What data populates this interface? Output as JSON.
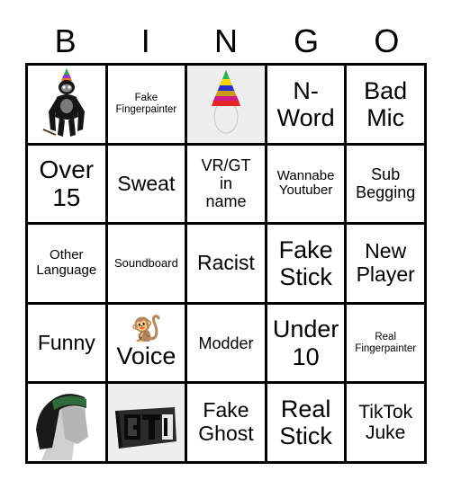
{
  "header": {
    "letters": [
      "B",
      "I",
      "N",
      "G",
      "O"
    ]
  },
  "cells": [
    {
      "type": "image",
      "icon": "gorilla-party-hat-icon"
    },
    {
      "type": "text",
      "text": "Fake Fingerpainter"
    },
    {
      "type": "image",
      "icon": "party-hat-icon"
    },
    {
      "type": "text",
      "text": "N- Word"
    },
    {
      "type": "text",
      "text": "Bad Mic"
    },
    {
      "type": "text",
      "text": "Over 15"
    },
    {
      "type": "text",
      "text": "Sweat"
    },
    {
      "type": "text",
      "text": "VR/GT in name"
    },
    {
      "type": "text",
      "text": "Wannabe Youtuber"
    },
    {
      "type": "text",
      "text": "Sub Begging"
    },
    {
      "type": "text",
      "text": "Other Language"
    },
    {
      "type": "text",
      "text": "Soundboard"
    },
    {
      "type": "text",
      "text": "Racist"
    },
    {
      "type": "text",
      "text": "Fake Stick"
    },
    {
      "type": "text",
      "text": "New Player"
    },
    {
      "type": "text",
      "text": "Funny"
    },
    {
      "type": "text",
      "text": "Voice",
      "emoji": "🐒"
    },
    {
      "type": "text",
      "text": "Modder"
    },
    {
      "type": "text",
      "text": "Under 10"
    },
    {
      "type": "text",
      "text": "Real Fingerpainter"
    },
    {
      "type": "image",
      "icon": "hair-bandana-head-icon"
    },
    {
      "type": "image",
      "icon": "gt-logo-sign-icon"
    },
    {
      "type": "text",
      "text": "Fake Ghost"
    },
    {
      "type": "text",
      "text": "Real Stick"
    },
    {
      "type": "text",
      "text": "TikTok Juke"
    }
  ]
}
